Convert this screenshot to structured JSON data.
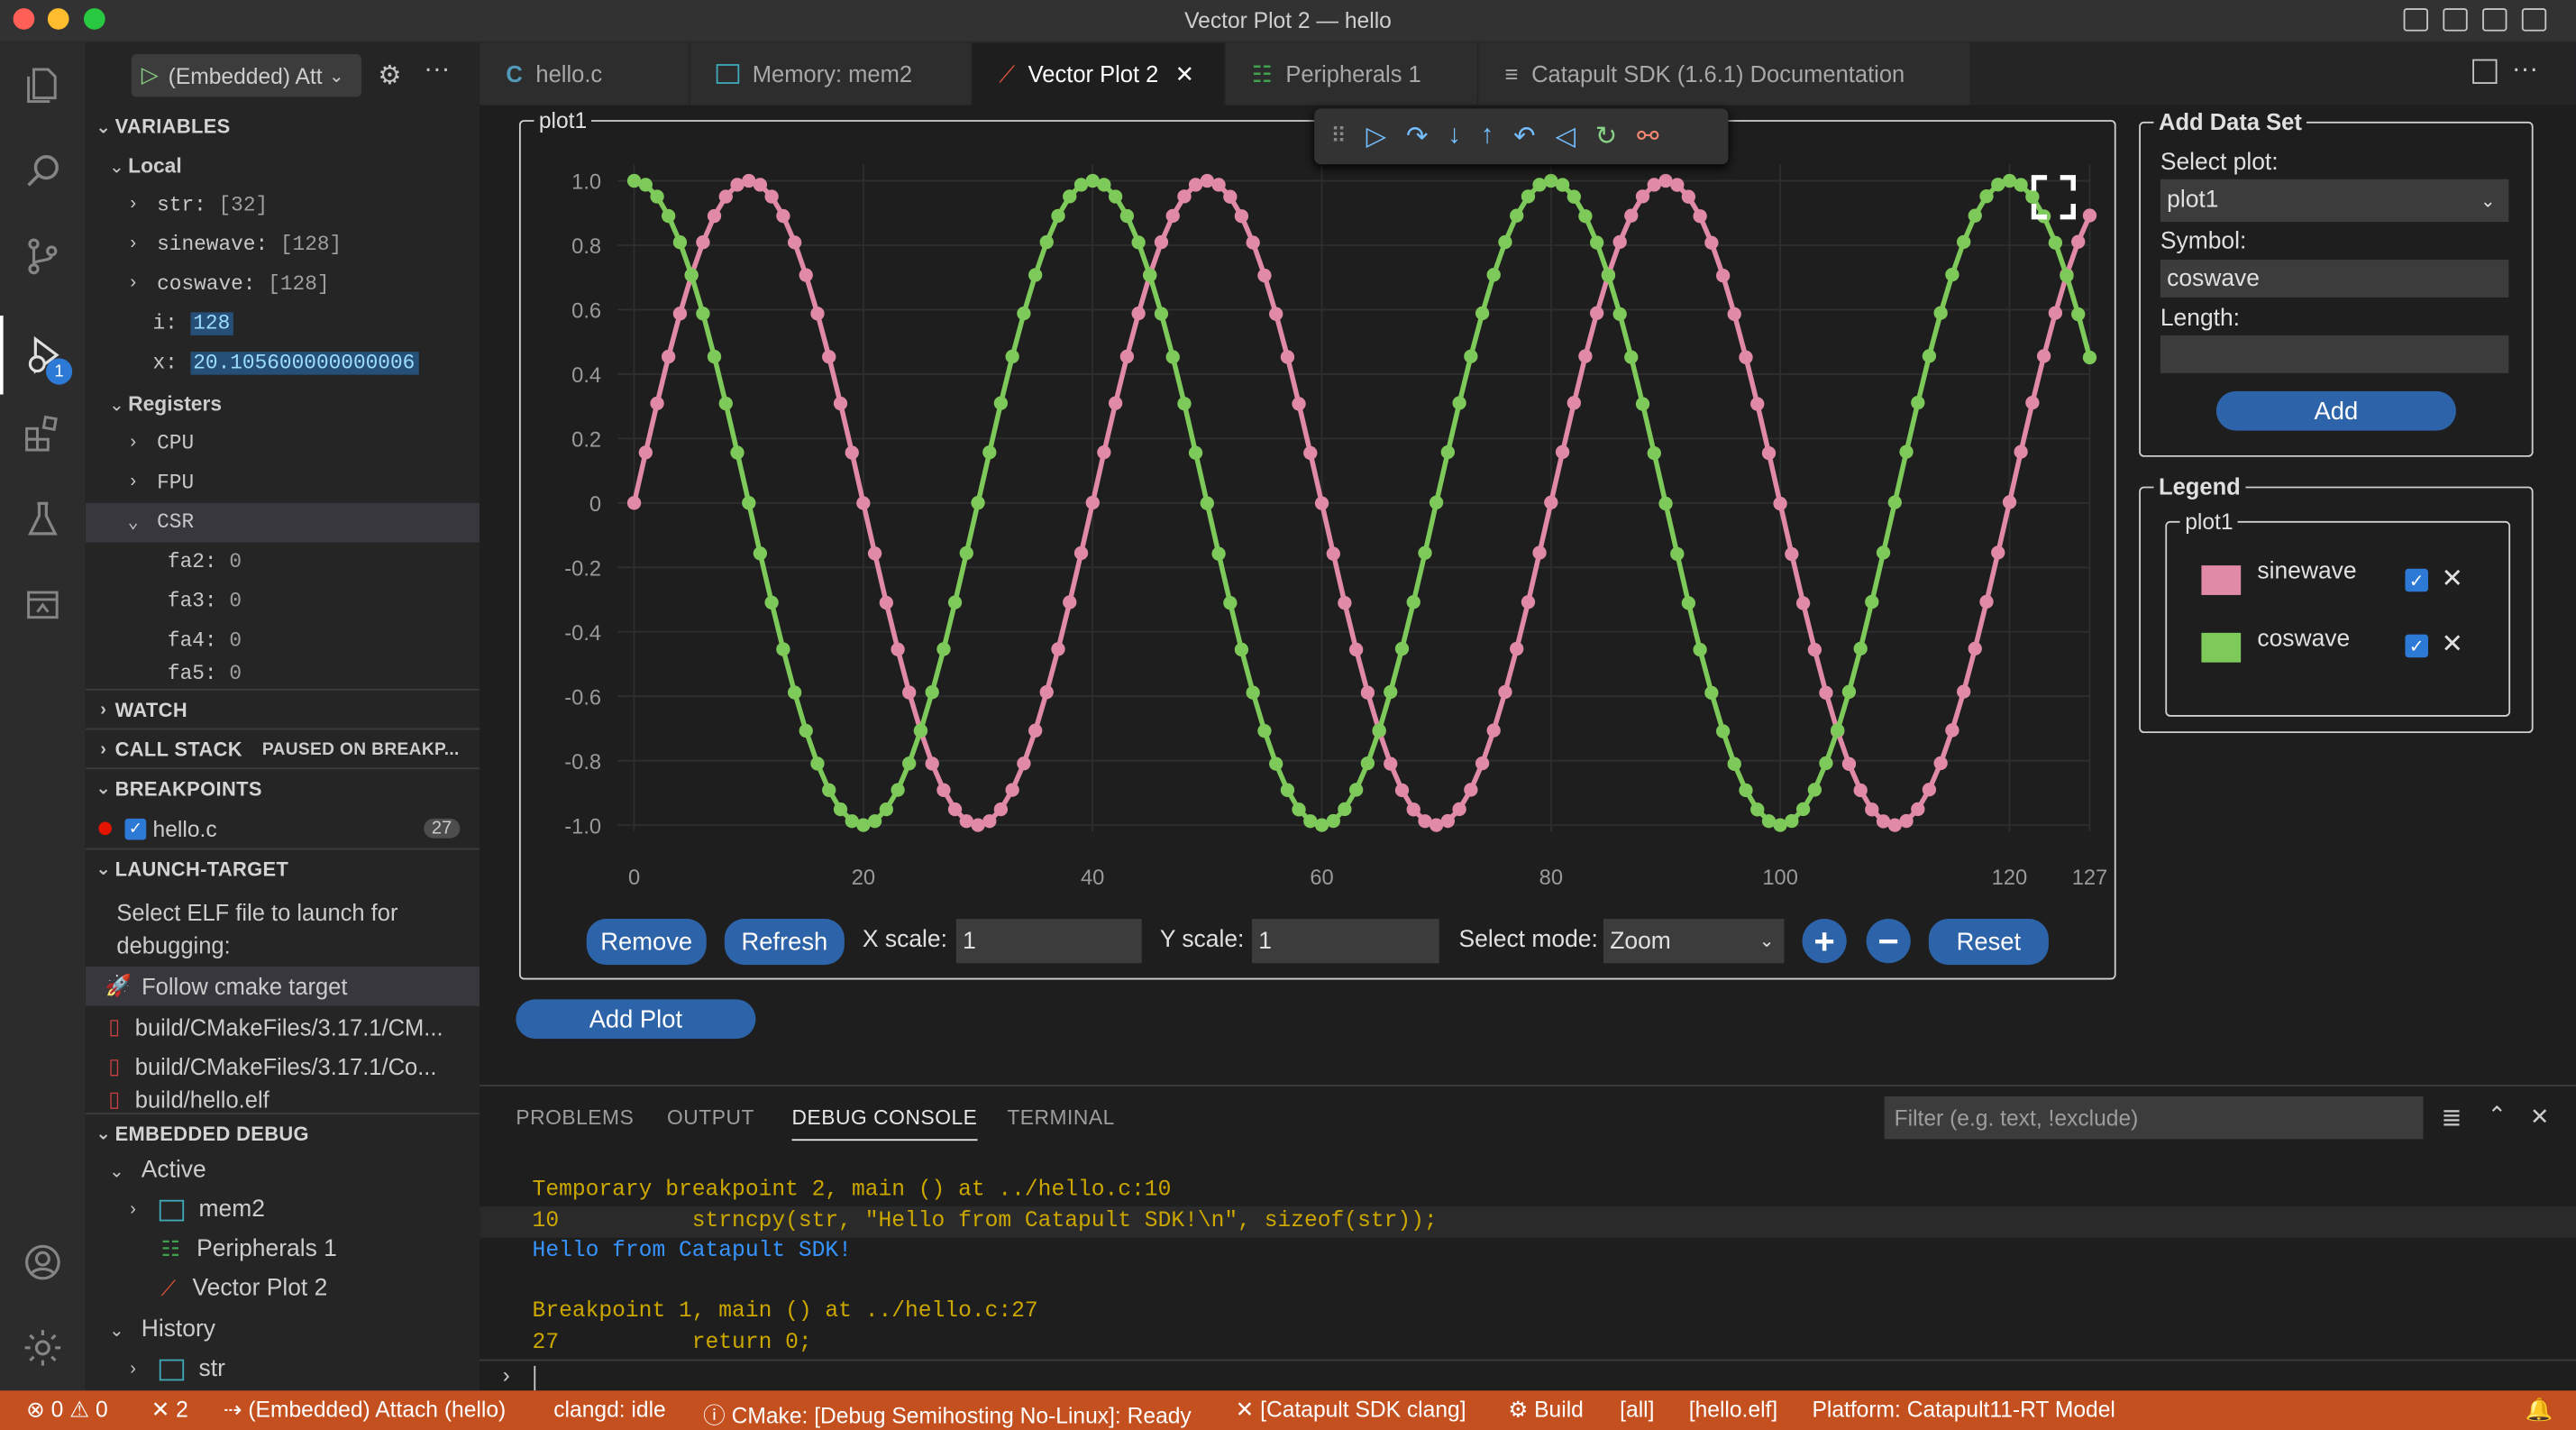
{
  "window": {
    "title": "Vector Plot 2 — hello"
  },
  "run": {
    "config": "(Embedded) Att"
  },
  "variables": {
    "header": "VARIABLES",
    "local_label": "Local",
    "locals": [
      {
        "name": "str:",
        "value": "[32]"
      },
      {
        "name": "sinewave:",
        "value": "[128]"
      },
      {
        "name": "coswave:",
        "value": "[128]"
      },
      {
        "name": "i:",
        "value": "128"
      },
      {
        "name": "x:",
        "value": "20.105600000000006"
      }
    ],
    "registers_label": "Registers",
    "register_groups": [
      "CPU",
      "FPU",
      "CSR"
    ],
    "csr": [
      {
        "name": "fa2:",
        "value": "0"
      },
      {
        "name": "fa3:",
        "value": "0"
      },
      {
        "name": "fa4:",
        "value": "0"
      },
      {
        "name": "fa5:",
        "value": "0"
      }
    ]
  },
  "watch": {
    "header": "WATCH"
  },
  "callstack": {
    "header": "CALL STACK",
    "status": "PAUSED ON BREAKP..."
  },
  "breakpoints": {
    "header": "BREAKPOINTS",
    "file": "hello.c",
    "count": "27"
  },
  "launch": {
    "header": "LAUNCH-TARGET",
    "prompt": "Select ELF file to launch for debugging:",
    "items": [
      "Follow cmake target",
      "build/CMakeFiles/3.17.1/CM...",
      "build/CMakeFiles/3.17.1/Co...",
      "build/hello.elf"
    ]
  },
  "embedded": {
    "header": "EMBEDDED DEBUG",
    "active_label": "Active",
    "active_items": [
      "mem2",
      "Peripherals 1",
      "Vector Plot 2"
    ],
    "history_label": "History",
    "history_items": [
      "str"
    ]
  },
  "tabs": [
    "hello.c",
    "Memory: mem2",
    "Vector Plot 2",
    "Peripherals 1",
    "Catapult SDK (1.6.1) Documentation"
  ],
  "plot": {
    "name": "plot1",
    "remove": "Remove",
    "refresh": "Refresh",
    "xscale_label": "X scale:",
    "xscale": "1",
    "yscale_label": "Y scale:",
    "yscale": "1",
    "mode_label": "Select mode:",
    "mode": "Zoom",
    "reset": "Reset",
    "add_plot": "Add Plot"
  },
  "chart_data": {
    "type": "line",
    "x": {
      "min": 0,
      "max": 127,
      "ticks": [
        0,
        20,
        40,
        60,
        80,
        100,
        120,
        127
      ]
    },
    "y": {
      "min": -1.0,
      "max": 1.0,
      "ticks": [
        "1.0",
        "0.8",
        "0.6",
        "0.4",
        "0.2",
        "0",
        "-0.2",
        "-0.4",
        "-0.6",
        "-0.8",
        "-1.0"
      ]
    },
    "grid": true,
    "series": [
      {
        "name": "sinewave",
        "color": "#e08aa8",
        "function": "sin",
        "step": 0.1571,
        "points": 128
      },
      {
        "name": "coswave",
        "color": "#7dc95a",
        "function": "cos",
        "step": 0.1571,
        "points": 128
      }
    ]
  },
  "add_dataset": {
    "title": "Add Data Set",
    "select_plot_label": "Select plot:",
    "select_plot": "plot1",
    "symbol_label": "Symbol:",
    "symbol": "coswave",
    "length_label": "Length:",
    "length": "",
    "add": "Add"
  },
  "legend": {
    "title": "Legend",
    "plot": "plot1",
    "items": [
      {
        "name": "sinewave",
        "color": "#e08aa8"
      },
      {
        "name": "coswave",
        "color": "#7dc95a"
      }
    ]
  },
  "panel": {
    "tabs": [
      "PROBLEMS",
      "OUTPUT",
      "DEBUG CONSOLE",
      "TERMINAL"
    ],
    "filter_placeholder": "Filter (e.g. text, !exclude)",
    "lines": [
      "Temporary breakpoint 2, main () at ../hello.c:10",
      "10          strncpy(str, \"Hello from Catapult SDK!\\n\", sizeof(str));",
      "Hello from Catapult SDK!",
      "",
      "Breakpoint 1, main () at ../hello.c:27",
      "27          return 0;"
    ]
  },
  "status": {
    "errors": "0",
    "warnings": "0",
    "tools": "2",
    "attach": "(Embedded) Attach (hello)",
    "clangd": "clangd: idle",
    "cmake": "CMake: [Debug Semihosting No-Linux]: Ready",
    "kit": "[Catapult SDK clang]",
    "build": "Build",
    "all": "[all]",
    "elf": "[hello.elf]",
    "platform": "Platform: Catapult11-RT Model"
  },
  "colors": {
    "accent": "#2d63a8",
    "statusbar": "#c4501f",
    "sine": "#e08aa8",
    "cos": "#7dc95a"
  }
}
